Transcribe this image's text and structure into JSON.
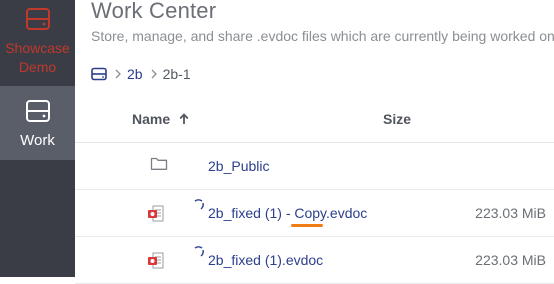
{
  "sidebar": {
    "items": [
      {
        "label": "Showcase Demo",
        "icon": "showcase-icon",
        "color": "#c0392b",
        "active": false
      },
      {
        "label": "Work",
        "icon": "work-icon",
        "color": "#ffffff",
        "active": true
      }
    ]
  },
  "header": {
    "title": "Work Center",
    "subtitle": "Store, manage, and share .evdoc files which are currently being worked on."
  },
  "breadcrumb": {
    "root_icon": "drive-icon",
    "items": [
      {
        "label": "2b",
        "link": true
      },
      {
        "label": "2b-1",
        "link": false
      }
    ]
  },
  "table": {
    "columns": {
      "name": "Name",
      "size": "Size"
    },
    "sort": {
      "column": "name",
      "direction": "ascending",
      "icon": "arrow-up-icon"
    },
    "rows": [
      {
        "type": "folder",
        "name": "2b_Public",
        "size": "",
        "icon": "folder-icon"
      },
      {
        "type": "file",
        "name": "2b_fixed (1) - Copy.evdoc",
        "size": "223.03 MiB",
        "icon": "evdoc-file-icon",
        "status": "syncing"
      },
      {
        "type": "file",
        "name": "2b_fixed (1).evdoc",
        "size": "223.03 MiB",
        "icon": "evdoc-file-icon",
        "status": "syncing"
      }
    ]
  },
  "colors": {
    "sidebar_bg": "#3a3d45",
    "sidebar_active_bg": "#5a5e68",
    "accent": "#2b3f8c",
    "danger": "#c0392b",
    "highlight": "#f07d12"
  }
}
